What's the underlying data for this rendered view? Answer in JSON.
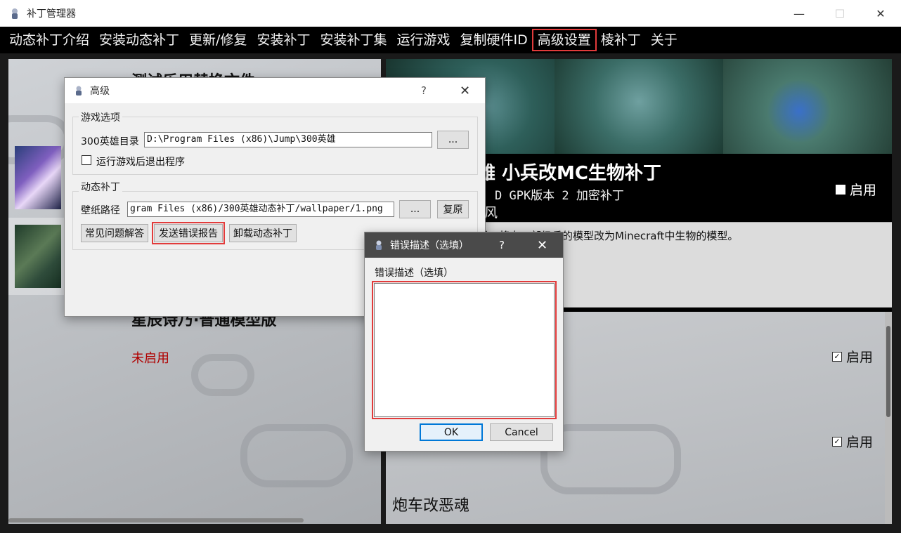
{
  "window": {
    "title": "补丁管理器",
    "minimize": "—",
    "maximize": "☐",
    "close": "✕"
  },
  "menu": {
    "items": [
      {
        "label": "动态补丁介绍"
      },
      {
        "label": "安装动态补丁"
      },
      {
        "label": "更新/修复"
      },
      {
        "label": "安装补丁"
      },
      {
        "label": "安装补丁集"
      },
      {
        "label": "运行游戏"
      },
      {
        "label": "复制硬件ID"
      },
      {
        "label": "高级设置",
        "highlighted": true
      },
      {
        "label": "棱补丁"
      },
      {
        "label": "关于"
      }
    ]
  },
  "left_panel": {
    "item1_title": "测试乐用替换文件",
    "item2_title": "星辰诗乃·普通模型版",
    "item2_status": "未启用"
  },
  "right_panel": {
    "heading": "雄 小兵改MC生物补丁",
    "sub": "D GPK版本 2 加密补丁",
    "sub2": "风",
    "enable1": "启用",
    "description": "后，将自一部级兵的模型改为Minecraft中生物的模型。",
    "list_enable_a": "启用",
    "list_enable_b": "启用",
    "list_item_title": "炮车改恶魂",
    "check_mark": "✓"
  },
  "advanced_dialog": {
    "title": "高级",
    "help": "?",
    "close": "✕",
    "game_group": "游戏选项",
    "dir_label": "300英雄目录",
    "dir_value": "D:\\Program Files (x86)\\Jump\\300英雄",
    "browse": "...",
    "exit_after_launch": "运行游戏后退出程序",
    "dyn_group": "动态补丁",
    "wallpaper_label": "壁纸路径",
    "wallpaper_value": "gram Files (x86)/300英雄动态补丁/wallpaper/1.png",
    "wallpaper_browse": "...",
    "restore": "复原",
    "faq": "常见问题解答",
    "send_report": "发送错误报告",
    "uninstall": "卸载动态补丁"
  },
  "error_dialog": {
    "title": "错误描述（选填）",
    "help": "?",
    "close": "✕",
    "label": "错误描述（选填）",
    "value": "",
    "ok": "OK",
    "cancel": "Cancel"
  }
}
